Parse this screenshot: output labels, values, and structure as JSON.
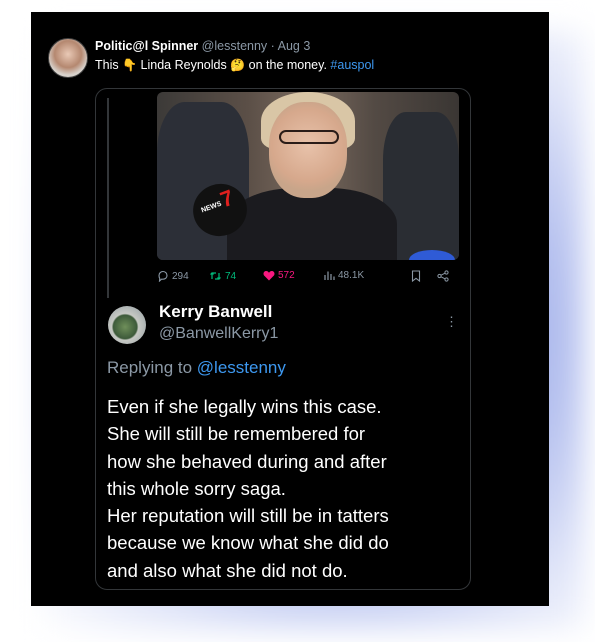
{
  "tweet": {
    "author_name": "Politic@l Spinner",
    "author_handle": "@lesstenny",
    "separator": "·",
    "date": "Aug 3",
    "text_before": "This",
    "emoji_1": "👇",
    "text_middle": "Linda Reynolds",
    "emoji_2": "🤔",
    "text_after": "on the money.",
    "hashtag": "#auspol"
  },
  "photo": {
    "mic_label": "NEWS",
    "mic_logo": "7"
  },
  "actions": {
    "replies": "294",
    "retweets": "74",
    "likes": "572",
    "views": "48.1K",
    "icons": [
      "reply-icon",
      "retweet-icon",
      "heart-icon",
      "views-icon",
      "bookmark-icon",
      "share-icon"
    ]
  },
  "reply": {
    "name": "Kerry Banwell",
    "handle": "@BanwellKerry1",
    "more": "⋮",
    "replying_prefix": "Replying to",
    "replying_mention": "@lesstenny",
    "lines": [
      "Even if she legally wins this case.",
      "She will still be remembered for",
      "how she behaved during and after",
      "this whole sorry saga.",
      "Her reputation will still be in tatters",
      "because we know what she did do",
      "and also what she did not do."
    ]
  },
  "colors": {
    "background": "#000000",
    "accent": "#3d98f0",
    "like": "#f91880",
    "retweet": "#00ba7c",
    "muted": "#8b98a5"
  }
}
